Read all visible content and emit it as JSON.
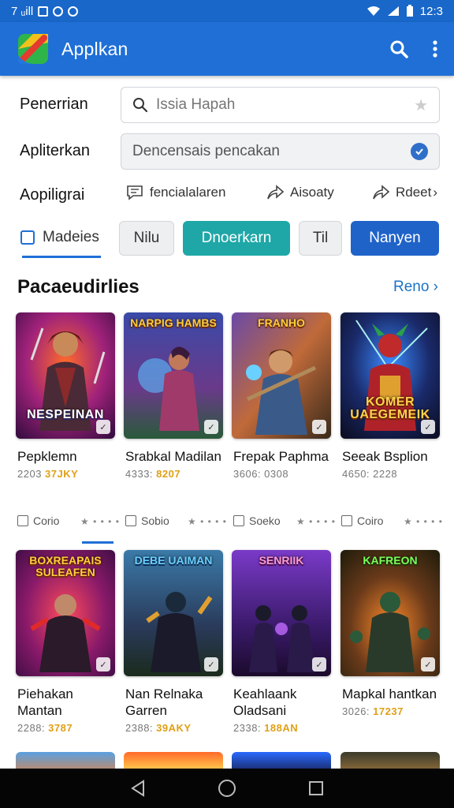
{
  "status": {
    "left_text": "7 ᵤill",
    "time": "12:3"
  },
  "appbar": {
    "title": "Applkan"
  },
  "form": {
    "search_label": "Penerrian",
    "search_placeholder": "Issia Hapah",
    "select_label": "Apliterkan",
    "select_value": "Dencensais pencakan",
    "actions_label": "Aopiligrai",
    "actions": [
      {
        "label": "fencialalaren",
        "icon": "chat-icon"
      },
      {
        "label": "Aisoaty",
        "icon": "share-icon"
      },
      {
        "label": "Rdeet",
        "icon": "share-arrow-icon"
      }
    ]
  },
  "tabs": {
    "first": "Madeies",
    "chips": [
      {
        "label": "Nilu",
        "style": "grey"
      },
      {
        "label": "Dnoerkarn",
        "style": "teal"
      },
      {
        "label": "Til",
        "style": "grey"
      },
      {
        "label": "Nanyen",
        "style": "blue"
      }
    ]
  },
  "section": {
    "title": "Pacaeudirlies",
    "more": "Reno"
  },
  "games_row1": [
    {
      "name": "Pepklemn",
      "meta_grey": "2203",
      "meta_yellow": "37JKY",
      "art_title": "NESPEINAN",
      "art_top": ""
    },
    {
      "name": "Srabkal Madilan",
      "meta_grey": "4333:",
      "meta_yellow": "8207",
      "art_title": "",
      "art_top": "NARPIG HAMBS"
    },
    {
      "name": "Frepak Paphma",
      "meta_grey": "3606: 0308",
      "meta_yellow": "",
      "art_title": "",
      "art_top": "FRANHO"
    },
    {
      "name": "Seeak Bsplion",
      "meta_grey": "4650: 2228",
      "meta_yellow": "",
      "art_title": "KOMER UAEGEMEIK",
      "art_top": ""
    }
  ],
  "row_line": [
    {
      "label": "Corio"
    },
    {
      "label": "Sobio"
    },
    {
      "label": "Soeko"
    },
    {
      "label": "Coiro"
    }
  ],
  "games_row2": [
    {
      "name": "Piehakan Mantan",
      "meta_grey": "2288:",
      "meta_yellow": "3787",
      "art_title": "",
      "art_top": "BOXREAPAIS SULEAFEN"
    },
    {
      "name": "Nan Relnaka Garren",
      "meta_grey": "2388:",
      "meta_yellow": "39AKY",
      "art_title": "",
      "art_top": "DEBE UAIMAN"
    },
    {
      "name": "Keahlaank Oladsani",
      "meta_grey": "2338:",
      "meta_yellow": "188AN",
      "art_title": "",
      "art_top": "SENRIIK"
    },
    {
      "name": "Mapkal hantkan",
      "meta_grey": "3026:",
      "meta_yellow": "17237",
      "art_title": "",
      "art_top": "KAFREON"
    }
  ],
  "colors": {
    "appbar": "#1f6fd6",
    "teal": "#1fa7a7",
    "blue": "#1f63c9",
    "link": "#1b72c5"
  }
}
